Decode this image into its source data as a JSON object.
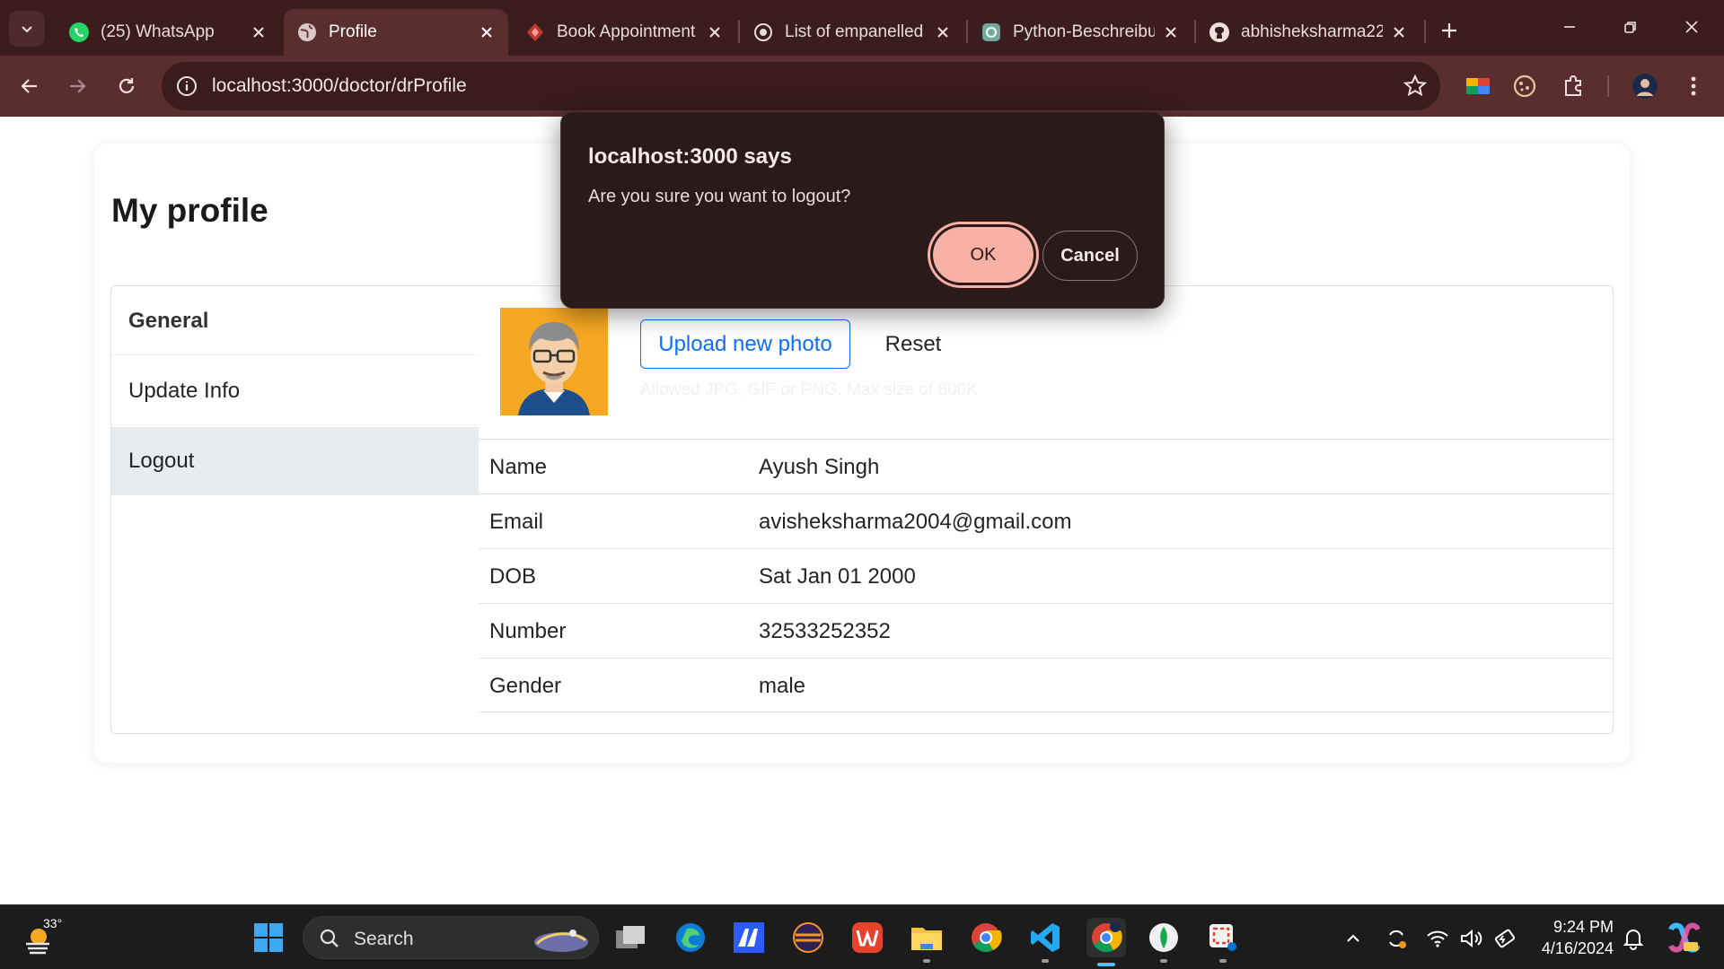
{
  "browser": {
    "tabs": [
      {
        "title": "(25) WhatsApp",
        "icon": "whatsapp-icon"
      },
      {
        "title": "Profile",
        "icon": "globe-icon"
      },
      {
        "title": "Book Appointment",
        "icon": "app-icon"
      },
      {
        "title": "List of empanelled",
        "icon": "seal-icon"
      },
      {
        "title": "Python-Beschreibu",
        "icon": "chatgpt-icon"
      },
      {
        "title": "abhisheksharma22",
        "icon": "github-icon"
      }
    ],
    "url": "localhost:3000/doctor/drProfile"
  },
  "page": {
    "title": "My profile",
    "sidebar": [
      {
        "label": "General"
      },
      {
        "label": "Update Info"
      },
      {
        "label": "Logout"
      }
    ],
    "upload_label": "Upload new photo",
    "reset_label": "Reset",
    "hint": "Allowed JPG, GIF or PNG. Max size of 800K",
    "fields": [
      {
        "label": "Name",
        "value": "Ayush Singh"
      },
      {
        "label": "Email",
        "value": "avisheksharma2004@gmail.com"
      },
      {
        "label": "DOB",
        "value": "Sat Jan 01 2000"
      },
      {
        "label": "Number",
        "value": "32533252352"
      },
      {
        "label": "Gender",
        "value": "male"
      }
    ]
  },
  "dialog": {
    "title": "localhost:3000 says",
    "message": "Are you sure you want to logout?",
    "ok": "OK",
    "cancel": "Cancel"
  },
  "taskbar": {
    "temperature": "33°",
    "search_label": "Search",
    "time": "9:24 PM",
    "date": "4/16/2024"
  },
  "colors": {
    "chrome_dark": "#3b1d1d",
    "chrome_toolbar": "#5a2e2e",
    "primary": "#0d6efd",
    "dialog_ok": "#f6b0a4"
  }
}
